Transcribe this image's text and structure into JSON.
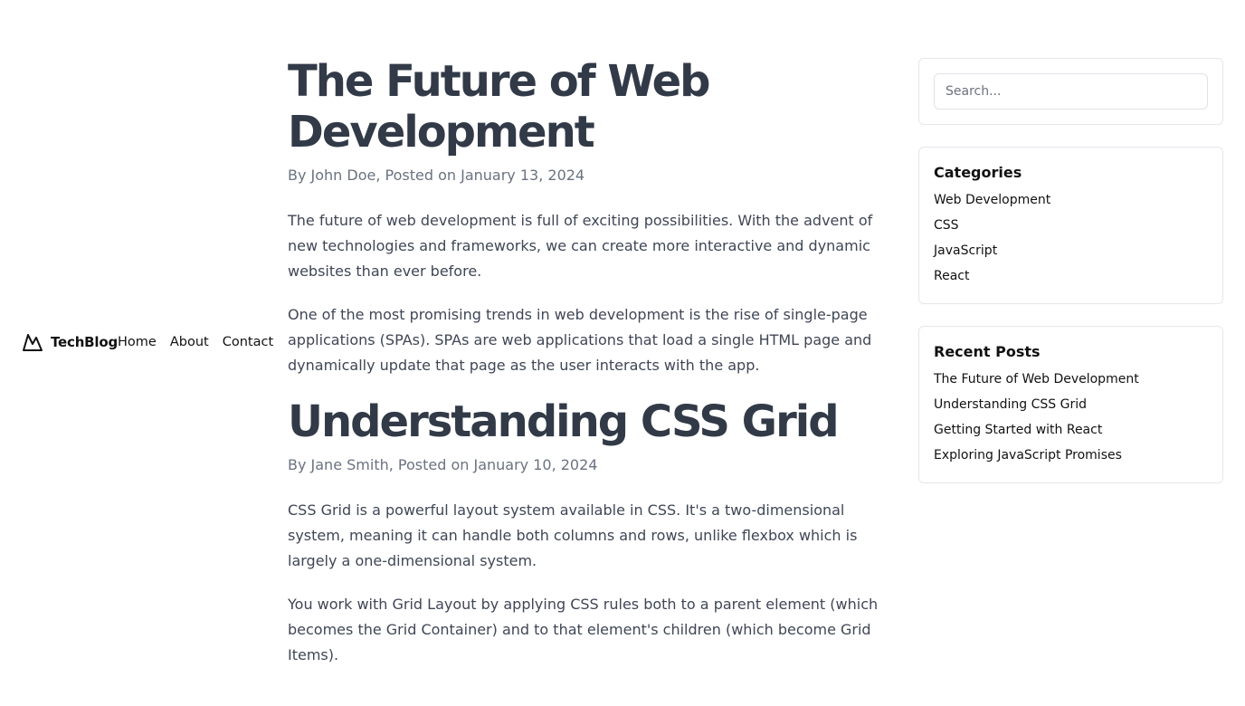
{
  "nav": {
    "brand": "TechBlog",
    "links": [
      "Home",
      "About",
      "Contact"
    ]
  },
  "posts": [
    {
      "title": "The Future of Web Development",
      "meta": "By John Doe, Posted on January 13, 2024",
      "paragraphs": [
        "The future of web development is full of exciting possibilities. With the advent of new technologies and frameworks, we can create more interactive and dynamic websites than ever before.",
        "One of the most promising trends in web development is the rise of single-page applications (SPAs). SPAs are web applications that load a single HTML page and dynamically update that page as the user interacts with the app."
      ]
    },
    {
      "title": "Understanding CSS Grid",
      "meta": "By Jane Smith, Posted on January 10, 2024",
      "paragraphs": [
        "CSS Grid is a powerful layout system available in CSS. It's a two-dimensional system, meaning it can handle both columns and rows, unlike flexbox which is largely a one-dimensional system.",
        "You work with Grid Layout by applying CSS rules both to a parent element (which becomes the Grid Container) and to that element's children (which become Grid Items)."
      ]
    }
  ],
  "sidebar": {
    "search": {
      "placeholder": "Search..."
    },
    "categories": {
      "title": "Categories",
      "items": [
        "Web Development",
        "CSS",
        "JavaScript",
        "React"
      ]
    },
    "recent": {
      "title": "Recent Posts",
      "items": [
        "The Future of Web Development",
        "Understanding CSS Grid",
        "Getting Started with React",
        "Exploring JavaScript Promises"
      ]
    }
  }
}
